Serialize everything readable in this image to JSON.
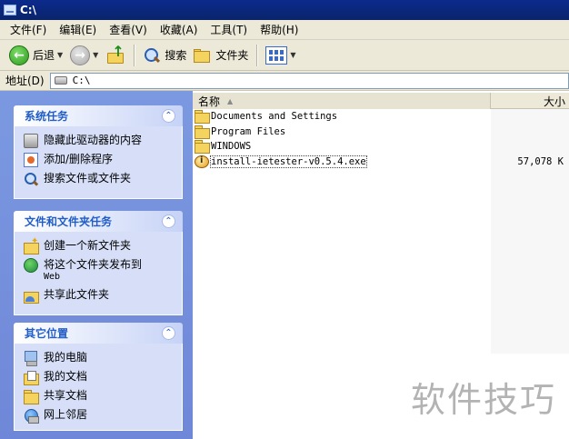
{
  "window": {
    "title": "C:\\"
  },
  "menu": [
    "文件(F)",
    "编辑(E)",
    "查看(V)",
    "收藏(A)",
    "工具(T)",
    "帮助(H)"
  ],
  "toolbar": {
    "back_label": "后退",
    "search_label": "搜索",
    "folders_label": "文件夹"
  },
  "address": {
    "label": "地址(D)",
    "value": "C:\\"
  },
  "panels": {
    "system": {
      "title": "系统任务",
      "items": [
        "隐藏此驱动器的内容",
        "添加/删除程序",
        "搜索文件或文件夹"
      ]
    },
    "file_tasks": {
      "title": "文件和文件夹任务",
      "items": [
        "创建一个新文件夹",
        "将这个文件夹发布到",
        "Web",
        "共享此文件夹"
      ]
    },
    "other_places": {
      "title": "其它位置",
      "items": [
        "我的电脑",
        "我的文档",
        "共享文档",
        "网上邻居"
      ]
    }
  },
  "columns": {
    "name": "名称",
    "size": "大小"
  },
  "files": [
    {
      "name": "Documents and Settings",
      "size": ""
    },
    {
      "name": "Program Files",
      "size": ""
    },
    {
      "name": "WINDOWS",
      "size": ""
    },
    {
      "name": "install-ietester-v0.5.4.exe",
      "size": "57,078 K"
    }
  ],
  "watermark": "软件技巧",
  "icons": {
    "collapse": "chevron-up-icon",
    "back": "back-arrow-icon",
    "forward": "forward-arrow-icon",
    "up": "folder-up-icon"
  }
}
